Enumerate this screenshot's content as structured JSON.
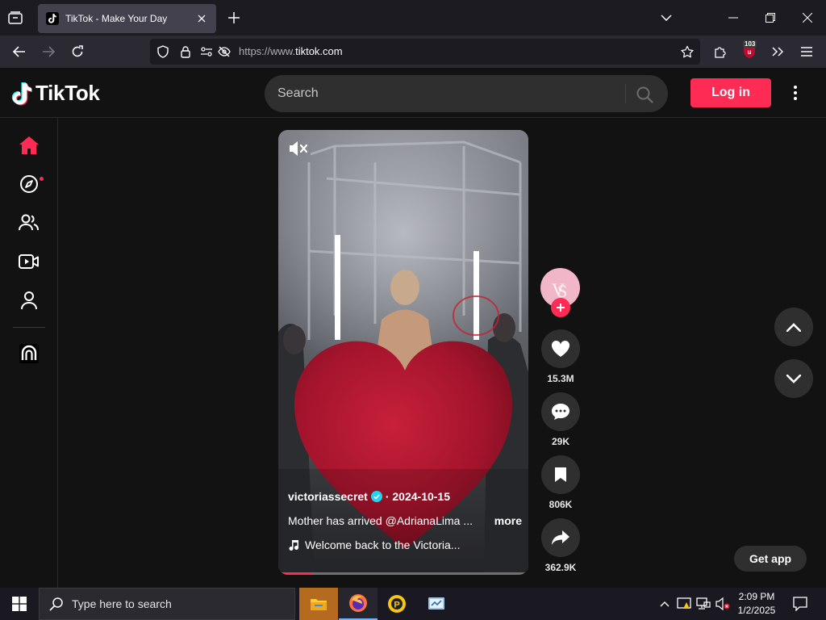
{
  "browser": {
    "tab_title": "TikTok - Make Your Day",
    "url_prefix": "https://www.",
    "url_host": "tiktok.com",
    "extension_badge": "103"
  },
  "header": {
    "logo_text": "TikTok",
    "search_placeholder": "Search",
    "login_label": "Log in"
  },
  "sidebar": {
    "items": [
      {
        "name": "home",
        "active": true
      },
      {
        "name": "explore",
        "notification_dot": true
      },
      {
        "name": "following"
      },
      {
        "name": "live"
      },
      {
        "name": "profile"
      },
      {
        "name": "more-apps"
      }
    ]
  },
  "video": {
    "author": "victoriassecret",
    "date": "· 2024-10-15",
    "caption": "Mother has arrived @AdrianaLima  ...",
    "more_label": "more",
    "sound": "Welcome back to the Victoria...",
    "progress": 0.14,
    "muted": true
  },
  "actions": {
    "likes": "15.3M",
    "comments": "29K",
    "bookmarks": "806K",
    "shares": "362.9K"
  },
  "get_app_label": "Get app",
  "taskbar": {
    "search_placeholder": "Type here to search",
    "time": "2:09 PM",
    "date": "1/2/2025"
  },
  "colors": {
    "brand": "#fe2c55",
    "background": "#121212",
    "surface": "#2f2f2f"
  }
}
